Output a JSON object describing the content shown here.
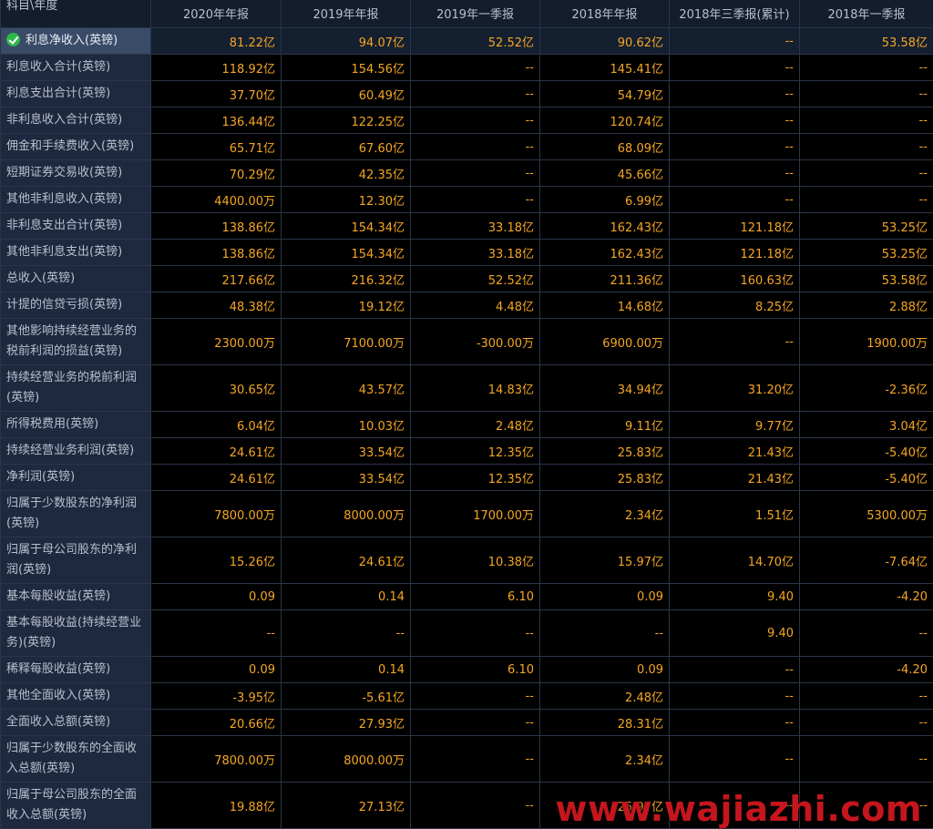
{
  "table": {
    "corner_label": "科目\\年度",
    "columns": [
      "2020年年报",
      "2019年年报",
      "2019年一季报",
      "2018年年报",
      "2018年三季报(累计)",
      "2018年一季报"
    ],
    "rows": [
      {
        "label": "利息净收入(英镑)",
        "values": [
          "81.22亿",
          "94.07亿",
          "52.52亿",
          "90.62亿",
          "--",
          "53.58亿"
        ]
      },
      {
        "label": "利息收入合计(英镑)",
        "values": [
          "118.92亿",
          "154.56亿",
          "--",
          "145.41亿",
          "--",
          "--"
        ]
      },
      {
        "label": "利息支出合计(英镑)",
        "values": [
          "37.70亿",
          "60.49亿",
          "--",
          "54.79亿",
          "--",
          "--"
        ]
      },
      {
        "label": "非利息收入合计(英镑)",
        "values": [
          "136.44亿",
          "122.25亿",
          "--",
          "120.74亿",
          "--",
          "--"
        ]
      },
      {
        "label": "佣金和手续费收入(英镑)",
        "values": [
          "65.71亿",
          "67.60亿",
          "--",
          "68.09亿",
          "--",
          "--"
        ]
      },
      {
        "label": "短期证券交易收(英镑)",
        "values": [
          "70.29亿",
          "42.35亿",
          "--",
          "45.66亿",
          "--",
          "--"
        ]
      },
      {
        "label": "其他非利息收入(英镑)",
        "values": [
          "4400.00万",
          "12.30亿",
          "--",
          "6.99亿",
          "--",
          "--"
        ]
      },
      {
        "label": "非利息支出合计(英镑)",
        "values": [
          "138.86亿",
          "154.34亿",
          "33.18亿",
          "162.43亿",
          "121.18亿",
          "53.25亿"
        ]
      },
      {
        "label": "其他非利息支出(英镑)",
        "values": [
          "138.86亿",
          "154.34亿",
          "33.18亿",
          "162.43亿",
          "121.18亿",
          "53.25亿"
        ]
      },
      {
        "label": "总收入(英镑)",
        "values": [
          "217.66亿",
          "216.32亿",
          "52.52亿",
          "211.36亿",
          "160.63亿",
          "53.58亿"
        ]
      },
      {
        "label": "计提的信贷亏损(英镑)",
        "values": [
          "48.38亿",
          "19.12亿",
          "4.48亿",
          "14.68亿",
          "8.25亿",
          "2.88亿"
        ]
      },
      {
        "label": "其他影响持续经营业务的税前利润的损益(英镑)",
        "values": [
          "2300.00万",
          "7100.00万",
          "-300.00万",
          "6900.00万",
          "--",
          "1900.00万"
        ]
      },
      {
        "label": "持续经营业务的税前利润(英镑)",
        "values": [
          "30.65亿",
          "43.57亿",
          "14.83亿",
          "34.94亿",
          "31.20亿",
          "-2.36亿"
        ]
      },
      {
        "label": "所得税费用(英镑)",
        "values": [
          "6.04亿",
          "10.03亿",
          "2.48亿",
          "9.11亿",
          "9.77亿",
          "3.04亿"
        ]
      },
      {
        "label": "持续经营业务利润(英镑)",
        "values": [
          "24.61亿",
          "33.54亿",
          "12.35亿",
          "25.83亿",
          "21.43亿",
          "-5.40亿"
        ]
      },
      {
        "label": "净利润(英镑)",
        "values": [
          "24.61亿",
          "33.54亿",
          "12.35亿",
          "25.83亿",
          "21.43亿",
          "-5.40亿"
        ]
      },
      {
        "label": "归属于少数股东的净利润(英镑)",
        "values": [
          "7800.00万",
          "8000.00万",
          "1700.00万",
          "2.34亿",
          "1.51亿",
          "5300.00万"
        ]
      },
      {
        "label": "归属于母公司股东的净利润(英镑)",
        "values": [
          "15.26亿",
          "24.61亿",
          "10.38亿",
          "15.97亿",
          "14.70亿",
          "-7.64亿"
        ]
      },
      {
        "label": "基本每股收益(英镑)",
        "values": [
          "0.09",
          "0.14",
          "6.10",
          "0.09",
          "9.40",
          "-4.20"
        ]
      },
      {
        "label": "基本每股收益(持续经营业务)(英镑)",
        "values": [
          "--",
          "--",
          "--",
          "--",
          "9.40",
          "--"
        ]
      },
      {
        "label": "稀释每股收益(英镑)",
        "values": [
          "0.09",
          "0.14",
          "6.10",
          "0.09",
          "--",
          "-4.20"
        ]
      },
      {
        "label": "其他全面收入(英镑)",
        "values": [
          "-3.95亿",
          "-5.61亿",
          "--",
          "2.48亿",
          "--",
          "--"
        ]
      },
      {
        "label": "全面收入总额(英镑)",
        "values": [
          "20.66亿",
          "27.93亿",
          "--",
          "28.31亿",
          "--",
          "--"
        ]
      },
      {
        "label": "归属于少数股东的全面收入总额(英镑)",
        "values": [
          "7800.00万",
          "8000.00万",
          "--",
          "2.34亿",
          "--",
          "--"
        ]
      },
      {
        "label": "归属于母公司股东的全面收入总额(英镑)",
        "values": [
          "19.88亿",
          "27.13亿",
          "--",
          "25.97亿",
          "--",
          "--"
        ]
      }
    ]
  },
  "watermark": "www.wajiazhi.com",
  "colors": {
    "background": "#000000",
    "label_bg": "#1e2940",
    "header_bg": "#131d2d",
    "value_text": "#f5a623",
    "label_text": "#b7c0cc",
    "border": "#2a3648",
    "watermark": "#c5161d",
    "check": "#2db94a"
  },
  "icons": {
    "selected_row_icon": "check-icon"
  }
}
